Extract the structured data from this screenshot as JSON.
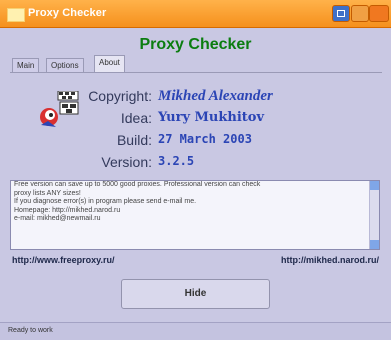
{
  "window": {
    "title": "Proxy Checker"
  },
  "heading": "Proxy Checker",
  "tabs": [
    {
      "label": "Main"
    },
    {
      "label": "Options"
    },
    {
      "label": "About"
    }
  ],
  "about": {
    "copyright_label": "Copyright:",
    "copyright_value": "Mikhed Alexander",
    "idea_label": "Idea:",
    "idea_value": "Yury Mukhitov",
    "build_label": "Build:",
    "build_value": "27 March 2003",
    "version_label": "Version:",
    "version_value": "3.2.5"
  },
  "info_lines": [
    "Free version can save up to 5000 good proxies. Professional version can check",
    "proxy lists ANY sizes!",
    "If you diagnose error(s) in program please send e-mail me.",
    "Homepage:   http://mikhed.narod.ru",
    "e-mail:   mikhed@newmail.ru"
  ],
  "links": {
    "left": "http://www.freeproxy.ru/",
    "right": "http://mikhed.narod.ru/"
  },
  "buttons": {
    "hide": "Hide"
  },
  "status": {
    "text": "Ready to work"
  }
}
